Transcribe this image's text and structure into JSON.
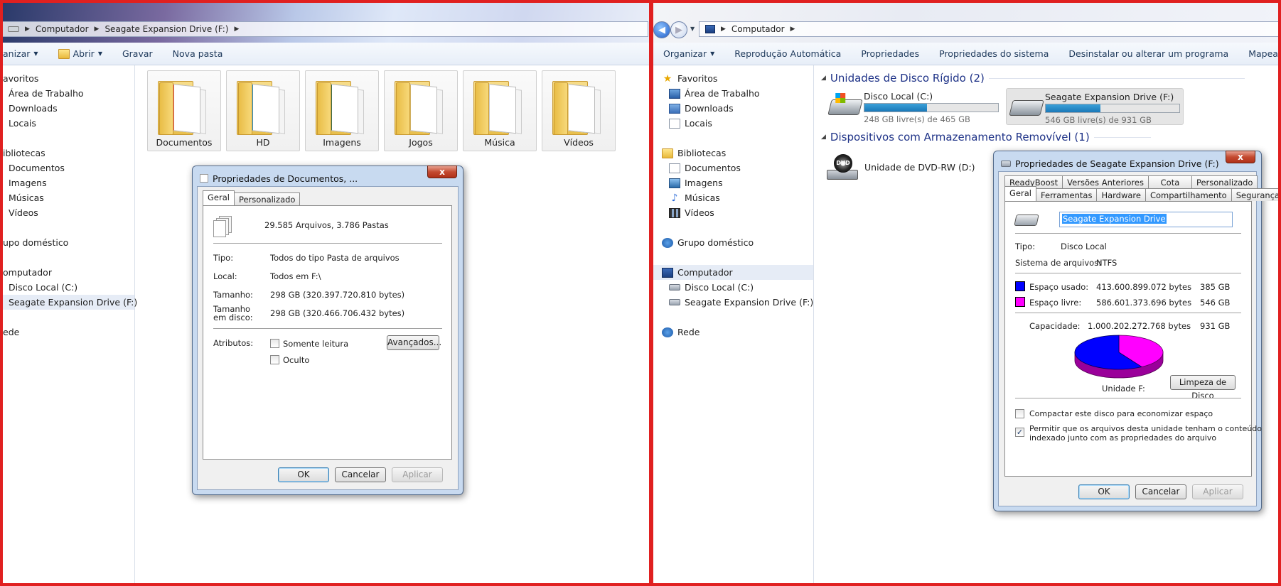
{
  "left": {
    "breadcrumb": [
      "Computador",
      "Seagate Expansion Drive (F:)"
    ],
    "toolbar": [
      "anizar",
      "Abrir",
      "Gravar",
      "Nova pasta"
    ],
    "nav": [
      {
        "label": "avoritos",
        "indent": 0
      },
      {
        "label": "Área de Trabalho",
        "indent": 1
      },
      {
        "label": "Downloads",
        "indent": 1
      },
      {
        "label": "Locais",
        "indent": 1
      },
      {
        "label": "",
        "indent": 0
      },
      {
        "label": "ibliotecas",
        "indent": 0
      },
      {
        "label": "Documentos",
        "indent": 1
      },
      {
        "label": "Imagens",
        "indent": 1
      },
      {
        "label": "Músicas",
        "indent": 1
      },
      {
        "label": "Vídeos",
        "indent": 1
      },
      {
        "label": "",
        "indent": 0
      },
      {
        "label": "upo doméstico",
        "indent": 0
      },
      {
        "label": "",
        "indent": 0
      },
      {
        "label": "omputador",
        "indent": 0
      },
      {
        "label": "Disco Local (C:)",
        "indent": 1
      },
      {
        "label": "Seagate Expansion Drive (F:)",
        "indent": 1,
        "selected": true
      },
      {
        "label": "",
        "indent": 0
      },
      {
        "label": "ede",
        "indent": 0
      }
    ],
    "folders": [
      "Documentos",
      "HD",
      "Imagens",
      "Jogos",
      "Música",
      "Vídeos"
    ],
    "dialog": {
      "title": "Propriedades de Documentos, ...",
      "close": "x",
      "tabs": [
        "Geral",
        "Personalizado"
      ],
      "summary": "29.585 Arquivos, 3.786 Pastas",
      "tipo_label": "Tipo:",
      "tipo_value": "Todos do tipo Pasta de arquivos",
      "local_label": "Local:",
      "local_value": "Todos em F:\\",
      "tamanho_label": "Tamanho:",
      "tamanho_value": "298 GB (320.397.720.810 bytes)",
      "disco_label_1": "Tamanho",
      "disco_label_2": "em disco:",
      "disco_value": "298 GB (320.466.706.432 bytes)",
      "atributos_label": "Atributos:",
      "somente_leitura": "Somente leitura",
      "oculto": "Oculto",
      "avancados": "Avançados...",
      "ok": "OK",
      "cancelar": "Cancelar",
      "aplicar": "Aplicar"
    }
  },
  "right": {
    "breadcrumb": [
      "Computador"
    ],
    "toolbar": [
      "Organizar",
      "Reprodução Automática",
      "Propriedades",
      "Propriedades do sistema",
      "Desinstalar ou alterar um programa",
      "Mapear unidade de rede"
    ],
    "nav": {
      "favoritos": "Favoritos",
      "area": "Área de Trabalho",
      "downloads": "Downloads",
      "locais": "Locais",
      "bibliotecas": "Bibliotecas",
      "documentos": "Documentos",
      "imagens": "Imagens",
      "musicas": "Músicas",
      "videos": "Vídeos",
      "grupo": "Grupo doméstico",
      "computador": "Computador",
      "disco_c": "Disco Local (C:)",
      "seagate": "Seagate Expansion Drive (F:)",
      "rede": "Rede"
    },
    "section_hd": "Unidades de Disco Rígido (2)",
    "section_rem": "Dispositivos com Armazenamento Removível (1)",
    "drives": [
      {
        "name": "Disco Local (C:)",
        "free": "248 GB livre(s) de 465 GB",
        "used_fraction": 0.47
      },
      {
        "name": "Seagate Expansion Drive (F:)",
        "free": "546 GB livre(s) de 931 GB",
        "used_fraction": 0.41
      }
    ],
    "dvd": "Unidade de DVD-RW (D:)",
    "dialog": {
      "title": "Propriedades de Seagate Expansion Drive (F:)",
      "close": "x",
      "tabs_top": [
        "ReadyBoost",
        "Versões Anteriores",
        "Cota",
        "Personalizado"
      ],
      "tabs_bottom": [
        "Geral",
        "Ferramentas",
        "Hardware",
        "Compartilhamento",
        "Segurança"
      ],
      "name_value": "Seagate Expansion Drive",
      "tipo_label": "Tipo:",
      "tipo_value": "Disco Local",
      "fs_label": "Sistema de arquivos:",
      "fs_value": "NTFS",
      "used_label": "Espaço usado:",
      "used_bytes": "413.600.899.072 bytes",
      "used_gb": "385 GB",
      "free_label": "Espaço livre:",
      "free_bytes": "586.601.373.696 bytes",
      "free_gb": "546 GB",
      "cap_label": "Capacidade:",
      "cap_bytes": "1.000.202.272.768 bytes",
      "cap_gb": "931 GB",
      "unit_label": "Unidade F:",
      "cleanup": "Limpeza de Disco",
      "compact": "Compactar este disco para economizar espaço",
      "index_1": "Permitir que os arquivos desta unidade tenham o conteúdo",
      "index_2": "indexado junto com as propriedades do arquivo",
      "ok": "OK",
      "cancelar": "Cancelar",
      "aplicar": "Aplicar",
      "used_fraction": 0.4135,
      "colors": {
        "used": "#0000ff",
        "free": "#ff00ff"
      }
    }
  }
}
